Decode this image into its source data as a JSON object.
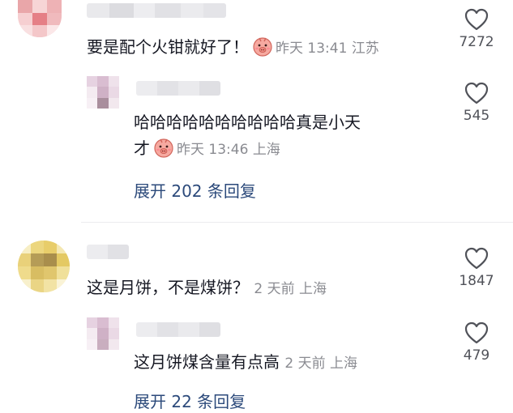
{
  "comments": [
    {
      "text": "要是配个火钳就好了！",
      "time": "昨天 13:41",
      "location": "江苏",
      "likes": "7272",
      "emoji": "shy-pig-emoji",
      "reply": {
        "text_line1": "哈哈哈哈哈哈哈哈哈哈真是小天",
        "text_line2": "才",
        "time": "昨天 13:46",
        "location": "上海",
        "likes": "545",
        "emoji": "shy-pig-emoji"
      },
      "expand_label": "展开 202 条回复"
    },
    {
      "text": "这是月饼，不是煤饼？",
      "time": "2 天前",
      "location": "上海",
      "likes": "1847",
      "reply": {
        "text_line1": "这月饼煤含量有点高",
        "time": "2 天前",
        "location": "上海",
        "likes": "479"
      },
      "expand_label": "展开 22 条回复"
    }
  ],
  "colors": {
    "link": "#2c4a7b",
    "meta": "#8a8b91",
    "text": "#161823"
  }
}
